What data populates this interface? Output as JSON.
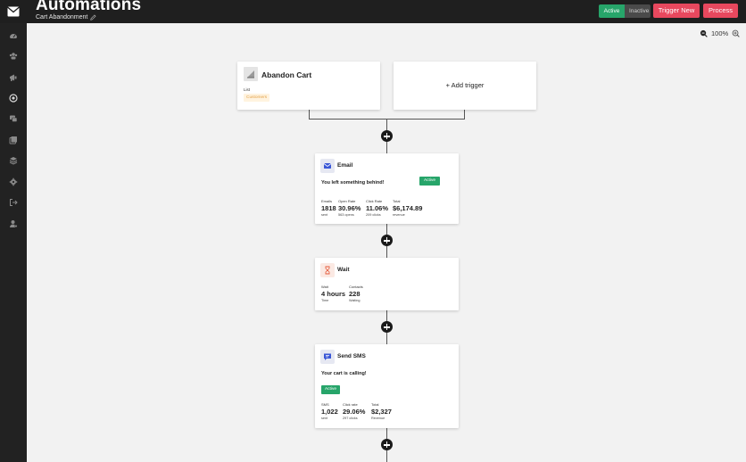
{
  "header": {
    "title": "Automations",
    "subtitle": "Cart Abandonment",
    "status_active": "Active",
    "status_inactive": "Inactive",
    "trigger_new": "Trigger New",
    "process": "Process"
  },
  "zoom": {
    "level": "100%"
  },
  "sidebar": {
    "items": [
      "dashboard-icon",
      "contacts-icon",
      "campaigns-icon",
      "automations-icon",
      "messages-icon",
      "templates-icon",
      "integrations-icon",
      "settings-icon",
      "logout-icon",
      "account-icon"
    ]
  },
  "trigger": {
    "title": "Abandon Cart",
    "list_label": "List",
    "list_value": "Customers",
    "add_trigger": "+ Add trigger"
  },
  "email": {
    "title": "Email",
    "message": "You left something behind!",
    "status": "Active",
    "stats": [
      {
        "label": "Emails",
        "value": "1818",
        "sub": "sent"
      },
      {
        "label": "Open Rate",
        "value": "30.96%",
        "sub": "563 opens"
      },
      {
        "label": "Click Rate",
        "value": "11.06%",
        "sub": "209 clicks"
      },
      {
        "label": "Total",
        "value": "$6,174.89",
        "sub": "revenue"
      }
    ]
  },
  "wait": {
    "title": "Wait",
    "stats": [
      {
        "label": "Wait",
        "value": "4 hours",
        "sub": "Time"
      },
      {
        "label": "Contacts",
        "value": "228",
        "sub": "Waiting"
      }
    ]
  },
  "sms": {
    "title": "Send SMS",
    "message": "Your cart is calling!",
    "status": "Active",
    "stats": [
      {
        "label": "SMS",
        "value": "1,022",
        "sub": "sent"
      },
      {
        "label": "Click rate",
        "value": "29.06%",
        "sub": "297 clicks"
      },
      {
        "label": "Total",
        "value": "$2,327",
        "sub": "Revenue"
      }
    ]
  }
}
